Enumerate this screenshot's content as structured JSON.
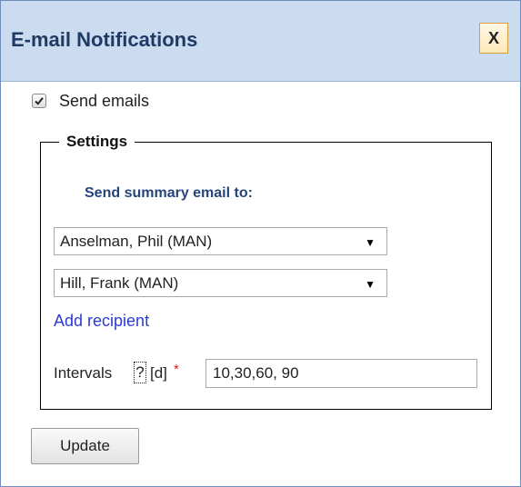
{
  "dialog": {
    "title": "E-mail Notifications",
    "close_label": "X"
  },
  "send_emails": {
    "label": "Send emails",
    "checked": true
  },
  "settings": {
    "legend": "Settings",
    "summary_label": "Send summary email to:",
    "recipients": [
      "Anselman, Phil (MAN)",
      "Hill, Frank (MAN)"
    ],
    "add_recipient_label": "Add recipient",
    "intervals": {
      "label": "Intervals",
      "help_glyph": "?",
      "unit": "[d]",
      "required_marker": "*",
      "value": "10,30,60, 90"
    }
  },
  "update_button": {
    "label": "Update"
  },
  "colors": {
    "title_bar": "#ccdcf0",
    "title_text": "#1f3a64",
    "link": "#2b3bd4",
    "required": "#cc2222"
  }
}
